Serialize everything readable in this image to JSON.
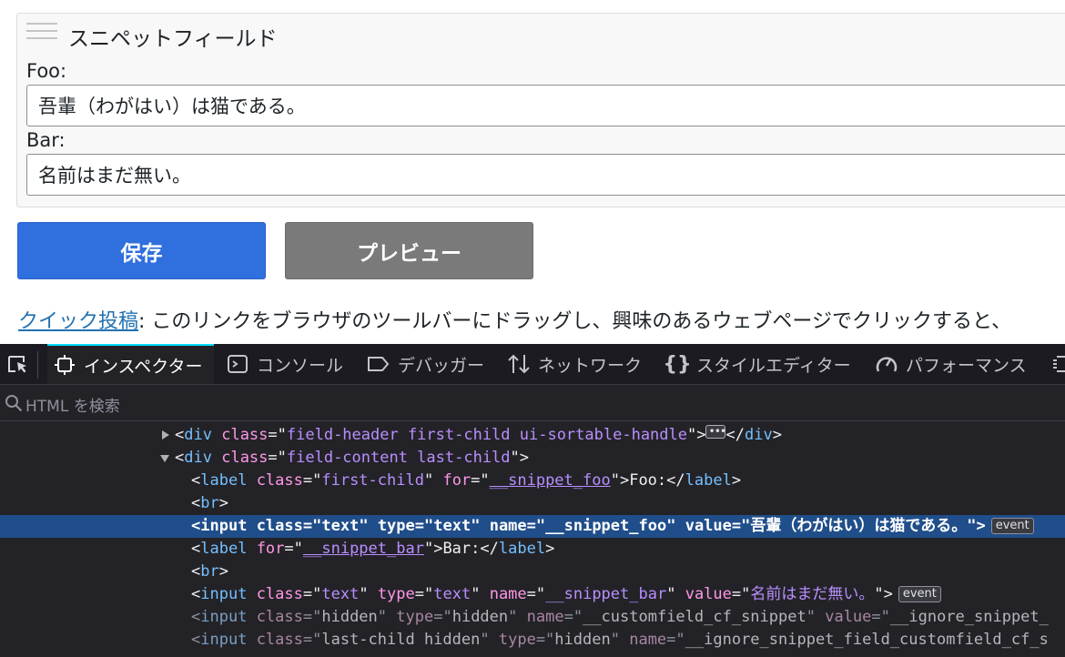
{
  "page": {
    "panel_title": "スニペットフィールド",
    "fields": [
      {
        "label": "Foo:",
        "value": "吾輩（わがはい）は猫である。"
      },
      {
        "label": "Bar:",
        "value": "名前はまだ無い。"
      }
    ],
    "save_label": "保存",
    "preview_label": "プレビュー",
    "quick_link": "クイック投稿",
    "quick_text": ": このリンクをブラウザのツールバーにドラッグし、興味のあるウェブページでクリックすると、"
  },
  "devtools": {
    "tabs": [
      {
        "label": "インスペクター",
        "icon": "inspector-icon",
        "active": true
      },
      {
        "label": "コンソール",
        "icon": "console-icon",
        "active": false
      },
      {
        "label": "デバッガー",
        "icon": "debugger-icon",
        "active": false
      },
      {
        "label": "ネットワーク",
        "icon": "network-icon",
        "active": false
      },
      {
        "label": "スタイルエディター",
        "icon": "style-editor-icon",
        "active": false
      },
      {
        "label": "パフォーマンス",
        "icon": "performance-icon",
        "active": false
      }
    ],
    "search_placeholder": "HTML を検索",
    "event_badge": "event",
    "row1": {
      "tag": "div",
      "attr": "class",
      "val": "field-header first-child ui-sortable-handle"
    },
    "row2": {
      "tag": "div",
      "attr": "class",
      "val": "field-content last-child"
    },
    "row3": {
      "tag": "label",
      "a1": "class",
      "v1": "first-child",
      "a2": "for",
      "v2": "__snippet_foo",
      "text": "Foo:"
    },
    "row4": {
      "tag": "br"
    },
    "row5": {
      "tag": "input",
      "a1": "class",
      "v1": "text",
      "a2": "type",
      "v2": "text",
      "a3": "name",
      "v3": "__snippet_foo",
      "a4": "value",
      "v4": "吾輩（わがはい）は猫である。"
    },
    "row6": {
      "tag": "label",
      "a1": "for",
      "v1": "__snippet_bar",
      "text": "Bar:"
    },
    "row7": {
      "tag": "br"
    },
    "row8": {
      "tag": "input",
      "a1": "class",
      "v1": "text",
      "a2": "type",
      "v2": "text",
      "a3": "name",
      "v3": "__snippet_bar",
      "a4": "value",
      "v4": "名前はまだ無い。"
    },
    "row9": {
      "tag": "input",
      "a1": "class",
      "v1": "hidden",
      "a2": "type",
      "v2": "hidden",
      "a3": "name",
      "v3": "__customfield_cf_snippet",
      "a4": "value",
      "v4": "__ignore_snippet_"
    },
    "row10": {
      "tag": "input",
      "a1": "class",
      "v1": "last-child hidden",
      "a2": "type",
      "v2": "hidden",
      "a3": "name",
      "v3": "__ignore_snippet_field_customfield_cf_s"
    }
  }
}
